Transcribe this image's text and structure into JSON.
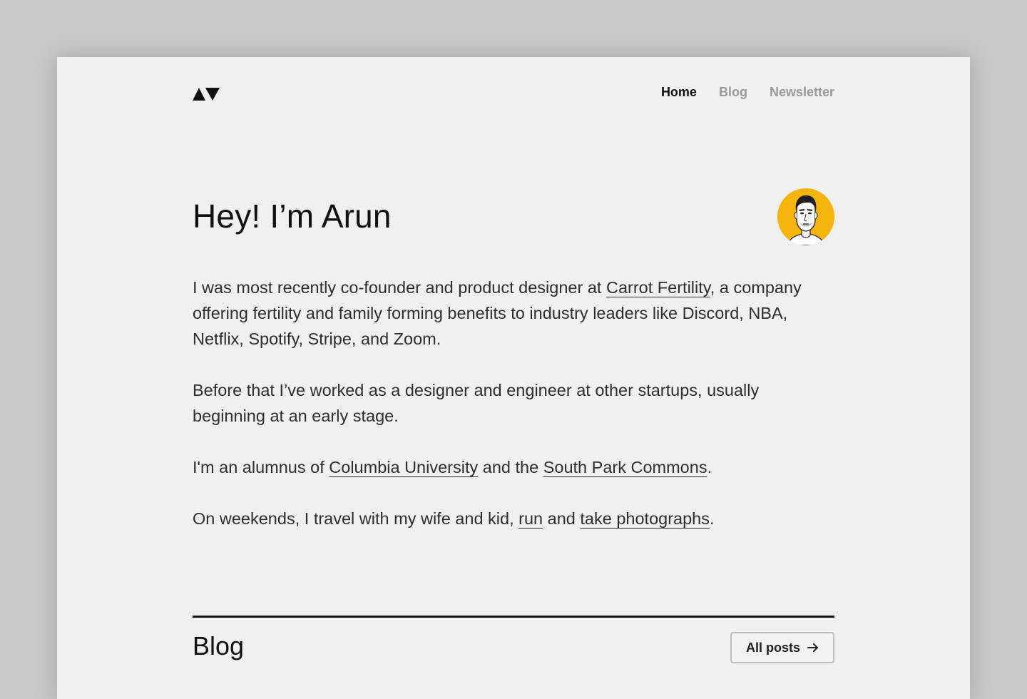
{
  "header": {
    "logo_icon": "av-triangles-logo",
    "nav": [
      {
        "label": "Home",
        "active": true
      },
      {
        "label": "Blog",
        "active": false
      },
      {
        "label": "Newsletter",
        "active": false
      }
    ]
  },
  "hero": {
    "title": "Hey! I’m Arun",
    "avatar_icon": "sketch-portrait-avatar",
    "avatar_bg": "#f5b40b"
  },
  "bio": {
    "p1": {
      "before": "I was most recently co-founder and product designer at ",
      "link": "Carrot Fertility",
      "after": ", a company offering fertility and family forming benefits to industry leaders like Discord, NBA, Netflix, Spotify, Stripe, and Zoom."
    },
    "p2": "Before that I’ve worked as a designer and engineer at other startups, usually beginning at an early stage.",
    "p3": {
      "before": "I'm an alumnus of ",
      "link1": "Columbia University",
      "middle": " and the ",
      "link2": "South Park Commons",
      "after": "."
    },
    "p4": {
      "before": "On weekends, I travel with my wife and kid, ",
      "link1": "run",
      "middle": " and ",
      "link2": "take photographs",
      "after": "."
    }
  },
  "blog": {
    "title": "Blog",
    "all_posts_label": "All posts",
    "arrow_icon": "arrow-right-icon"
  },
  "colors": {
    "page_bg": "#f0f0f0",
    "outer_bg": "#c8c8c8",
    "text": "#2e2e2e",
    "nav_inactive": "#999999",
    "accent": "#f5b40b"
  }
}
